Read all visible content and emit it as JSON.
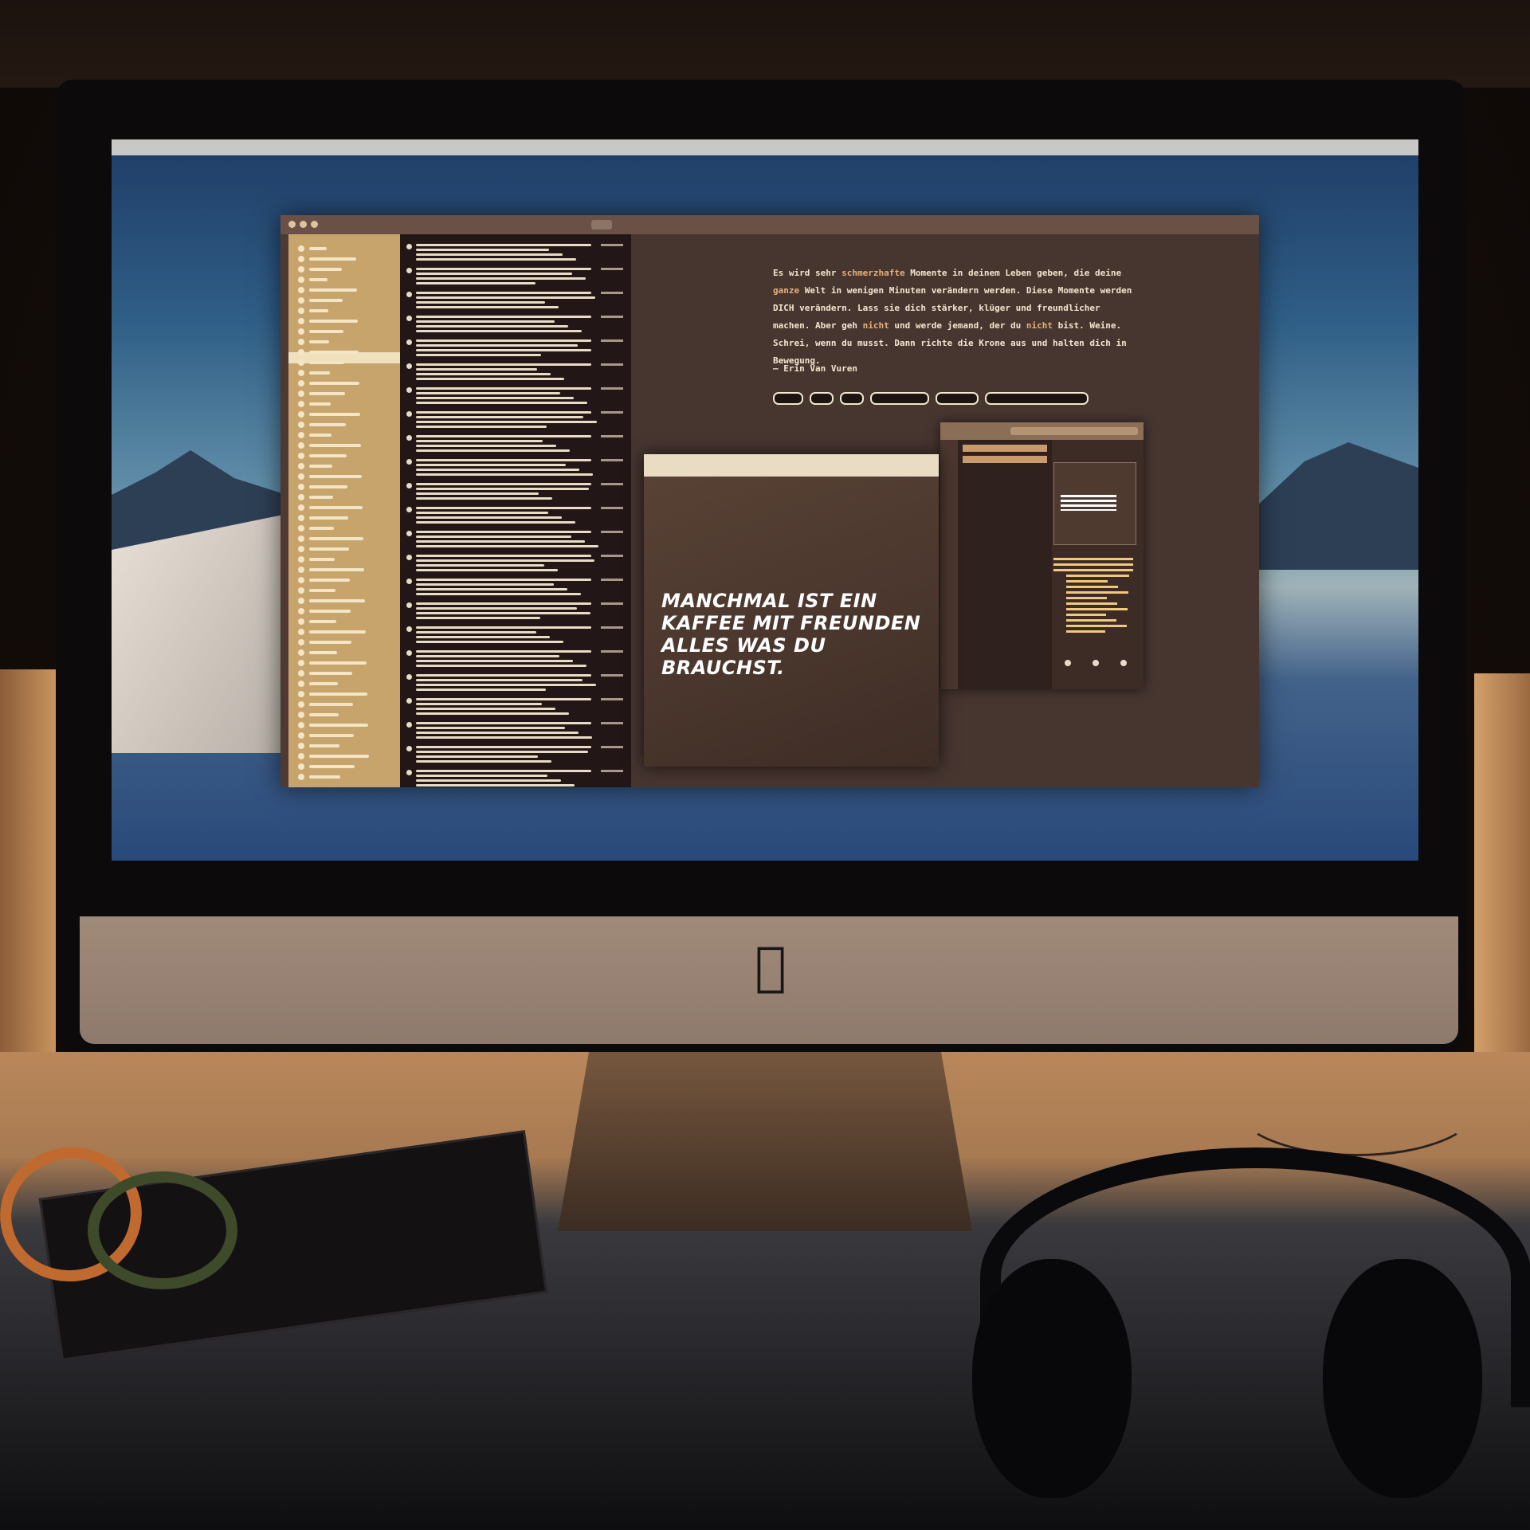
{
  "scene": {
    "description_role": "photo of desktop computer"
  },
  "menubar": {
    "items": [
      "",
      "",
      "",
      "",
      "",
      "",
      ""
    ]
  },
  "notes_window": {
    "title": "",
    "note_list_footer": "",
    "editor": {
      "quote_segments": [
        {
          "text": "Es wird sehr ",
          "highlight": false
        },
        {
          "text": "schmerzhafte",
          "highlight": true
        },
        {
          "text": " Momente in deinem Leben geben, die deine ",
          "highlight": false
        },
        {
          "text": "ganze",
          "highlight": true
        },
        {
          "text": " Welt in wenigen Minuten verändern werden. Diese Momente werden DICH verändern. Lass sie dich stärker, klüger und freundlicher machen. Aber geh ",
          "highlight": false
        },
        {
          "text": "nicht",
          "highlight": true
        },
        {
          "text": " und werde jemand, der du ",
          "highlight": false
        },
        {
          "text": "nicht",
          "highlight": true
        },
        {
          "text": " bist. Weine. Schrei, wenn du musst. Dann richte die Krone aus und halten dich in Bewegung.",
          "highlight": false
        }
      ],
      "author": "— Erin Van Vuren"
    }
  },
  "preview_window": {
    "quote_lines": [
      "MANCHMAL IST EIN",
      "KAFFEE MIT FREUNDEN",
      "ALLES WAS DU BRAUCHST."
    ]
  },
  "colors": {
    "editor_bg": "#473530",
    "sidebar_bg": "#c7a46c",
    "highlight": "#e8b07a",
    "preview_text": "#ffffff"
  }
}
